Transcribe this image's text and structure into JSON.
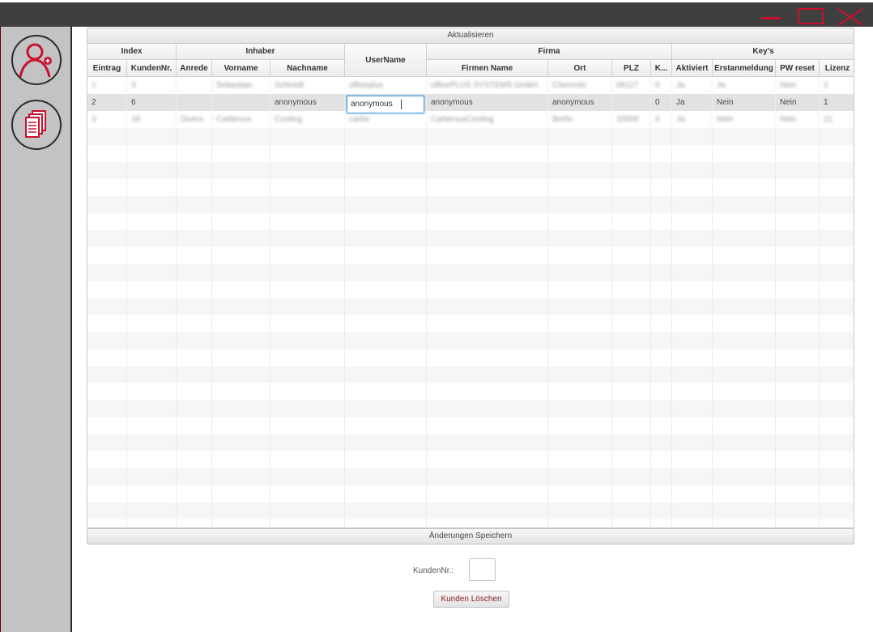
{
  "toolbar": {
    "update_label": "Aktualisieren",
    "save_label": "Änderungen Speichern"
  },
  "sidebar": {
    "items": [
      {
        "icon": "add-user-icon"
      },
      {
        "icon": "documents-icon"
      }
    ]
  },
  "table": {
    "groups": {
      "index": "Index",
      "owner": "Inhaber",
      "username": "UserName",
      "company": "Firma",
      "keys": "Key's"
    },
    "columns": {
      "entry": "Eintrag",
      "customer_no": "KundenNr.",
      "salutation": "Anrede",
      "first_name": "Vorname",
      "last_name": "Nachname",
      "company_name": "Firmen Name",
      "city": "Ort",
      "zip": "PLZ",
      "k": "K...",
      "activated": "Aktiviert",
      "first_login": "Erstanmeldung",
      "pw_reset": "PW reset",
      "license": "Lizenz"
    },
    "rows": [
      {
        "entry": "1",
        "customer_no": "3",
        "salutation": "",
        "first_name": "Sebastian",
        "last_name": "Schmidt",
        "username": "officeplus",
        "company_name": "officePLUS SYSTEMS GmbH",
        "city": "Chemnitz",
        "zip": "09117",
        "k": "0",
        "activated": "Ja",
        "first_login": "Ja",
        "pw_reset": "Nein",
        "license": "2"
      },
      {
        "entry": "2",
        "customer_no": "6",
        "salutation": "",
        "first_name": "",
        "last_name": "anonymous",
        "username": "anonymous",
        "company_name": "anonymous",
        "city": "anonymous",
        "zip": "",
        "k": "0",
        "activated": "Ja",
        "first_login": "Nein",
        "pw_reset": "Nein",
        "license": "1"
      },
      {
        "entry": "3",
        "customer_no": "18",
        "salutation": "Divers",
        "first_name": "Carbenus",
        "last_name": "Cooling",
        "username": "carbo",
        "company_name": "CarbenusCooling",
        "city": "Berlin",
        "zip": "10000",
        "k": "0",
        "activated": "Ja",
        "first_login": "Nein",
        "pw_reset": "Nein",
        "license": "21"
      }
    ],
    "editing_value": "anonymous"
  },
  "delete_form": {
    "label": "KundenNr.:",
    "value": "",
    "button_label": "Kunden Löschen"
  },
  "colors": {
    "accent": "#c8102e",
    "titlebar": "#3f3f3f",
    "sidebar": "#c3c3c3",
    "focus": "#4aa3df"
  }
}
